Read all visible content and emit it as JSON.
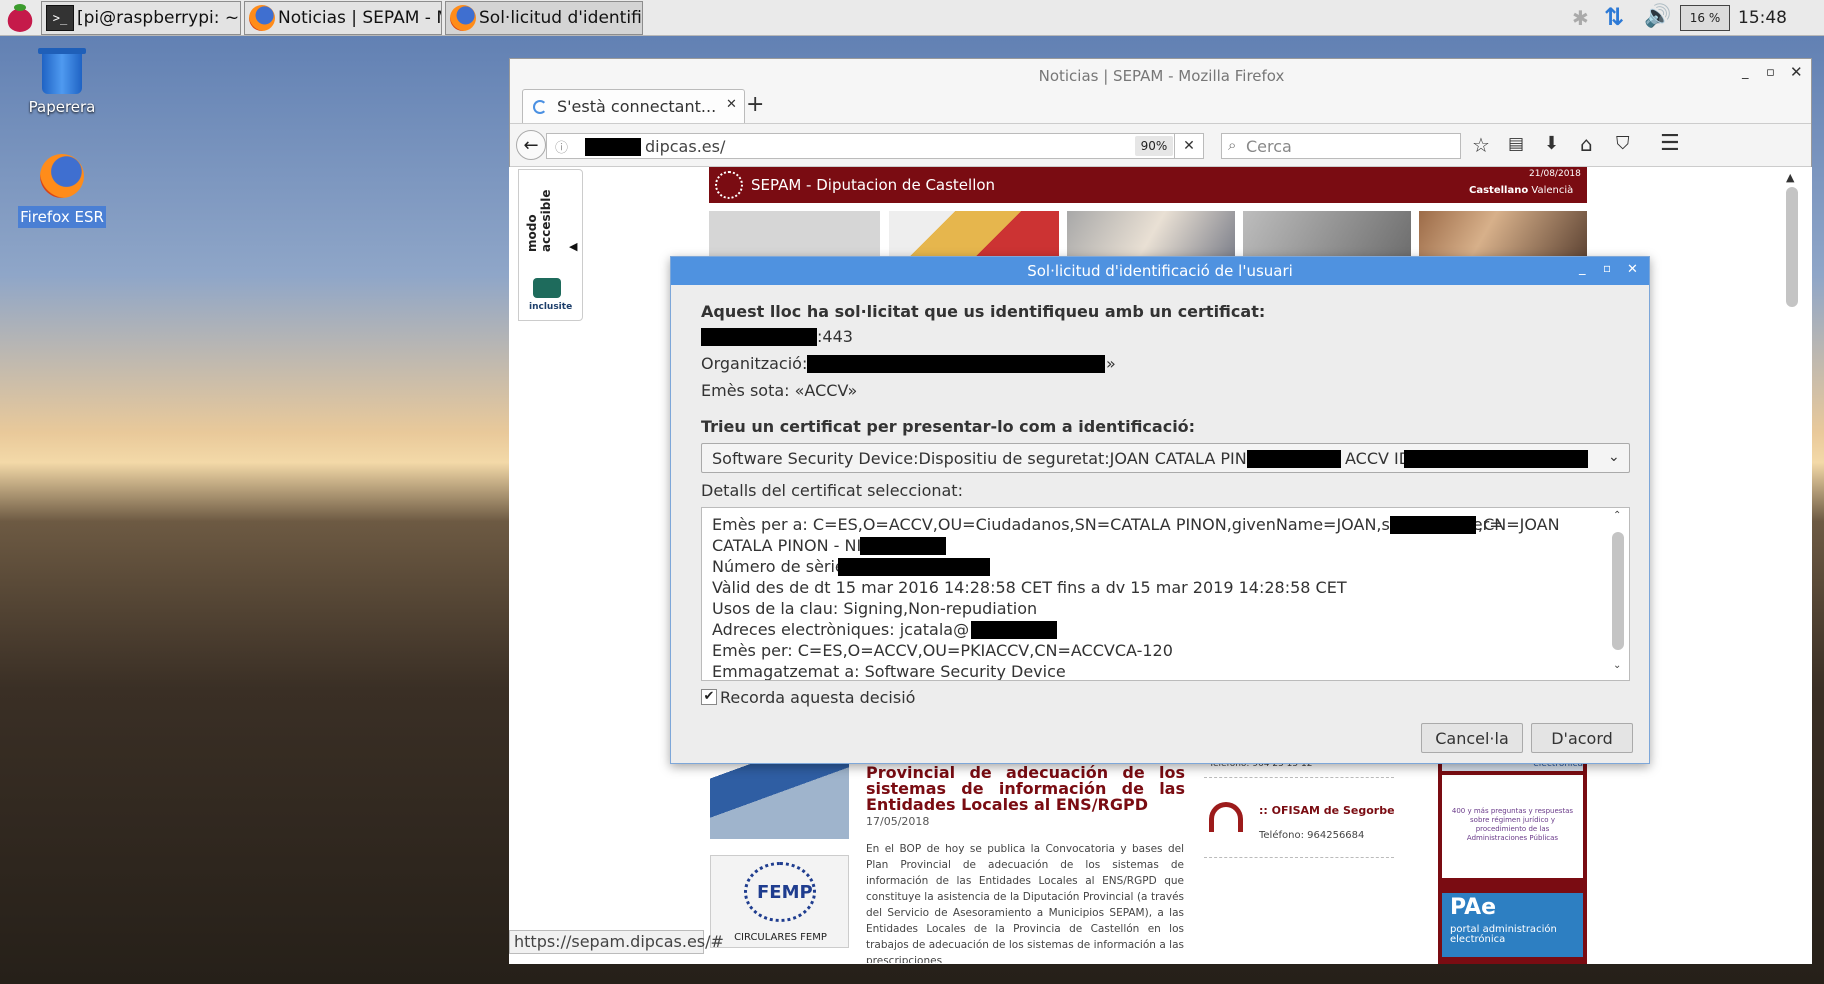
{
  "taskbar": {
    "tasks": [
      "[pi@raspberrypi: ~]",
      "Noticias | SEPAM - M...",
      "Sol·licitud d'identifica..."
    ],
    "cpu": "16 %",
    "clock": "15:48"
  },
  "desktop": {
    "trash": "Paperera",
    "firefox": "Firefox ESR"
  },
  "browser": {
    "window_title": "Noticias | SEPAM - Mozilla Firefox",
    "tab_label": "S'està connectant...",
    "url": "dipcas.es/",
    "zoom": "90%",
    "search_placeholder": "Cerca",
    "status_url": "https://sepam.dipcas.es/#"
  },
  "site": {
    "header": "SEPAM - Diputacion de Castellon",
    "date": "21/08/2018",
    "lang_es": "Castellano",
    "lang_va": "Valencià",
    "modo_accesible": "modo accesible",
    "inclusite": "inclusite",
    "news_title": "Provincial de adecuación de los sistemas de información de las Entidades Locales al ENS/RGPD",
    "news_date": "17/05/2018",
    "news_body": "En el BOP de hoy se publica la Convocatoria y bases del Plan Provincial de adecuación de los sistemas de información de las Entidades Locales al ENS/RGPD que constituye la asistencia de la Diputación Provincial (a través del Servicio de Asesoramiento a Municipios SEPAM), a las Entidades Locales de la Provincia de Castellón en los trabajos de adecuación de los sistemas de información a las prescripciones",
    "femp": "FEMP",
    "femp_caption": "CIRCULARES FEMP",
    "ofisam_phone_top": "Teléfono: 964 25 15 12",
    "ofisam_name": ":: OFISAM de Segorbe",
    "ofisam_phone": "Teléfono: 964256684",
    "pae_title": "PAe",
    "pae_sub": "portal administración electrónica",
    "ad_line": "400 y más preguntas y respuestas sobre régimen jurídico y procedimiento de las Administraciones Públicas",
    "ad_electronica": "electrónica"
  },
  "dialog": {
    "title": "Sol·licitud d'identificació de l'usuari",
    "intro": "Aquest lloc ha sol·licitat que us identifiqueu amb un certificat:",
    "port": ":443",
    "org_label": "Organització: «",
    "org_end": "»",
    "issued_under": "Emès sota: «ACCV»",
    "choose_label": "Trieu un certificat per presentar-lo com a identificació:",
    "select_prefix": "Software Security Device:Dispositiu de seguretat:JOAN CATALA PINON - NIF",
    "select_mid": "ACCV ID",
    "details_label": "Detalls del certificat seleccionat:",
    "details": [
      "Emès per a: C=ES,O=ACCV,OU=Ciudadanos,SN=CATALA PINON,givenName=JOAN,serialNumber=",
      ",CN=JOAN",
      "CATALA PINON - NIF:",
      "Número de sèrie:",
      "Vàlid des de dt 15 mar 2016 14:28:58 CET fins a dv 15 mar 2019 14:28:58 CET",
      "Usos de la clau: Signing,Non-repudiation",
      "Adreces electròniques: jcatala@",
      "Emès per: C=ES,O=ACCV,OU=PKIACCV,CN=ACCVCA-120",
      "Emmagatzemat a: Software Security Device"
    ],
    "remember": "Recorda aquesta decisió",
    "cancel": "Cancel·la",
    "ok": "D'acord"
  }
}
